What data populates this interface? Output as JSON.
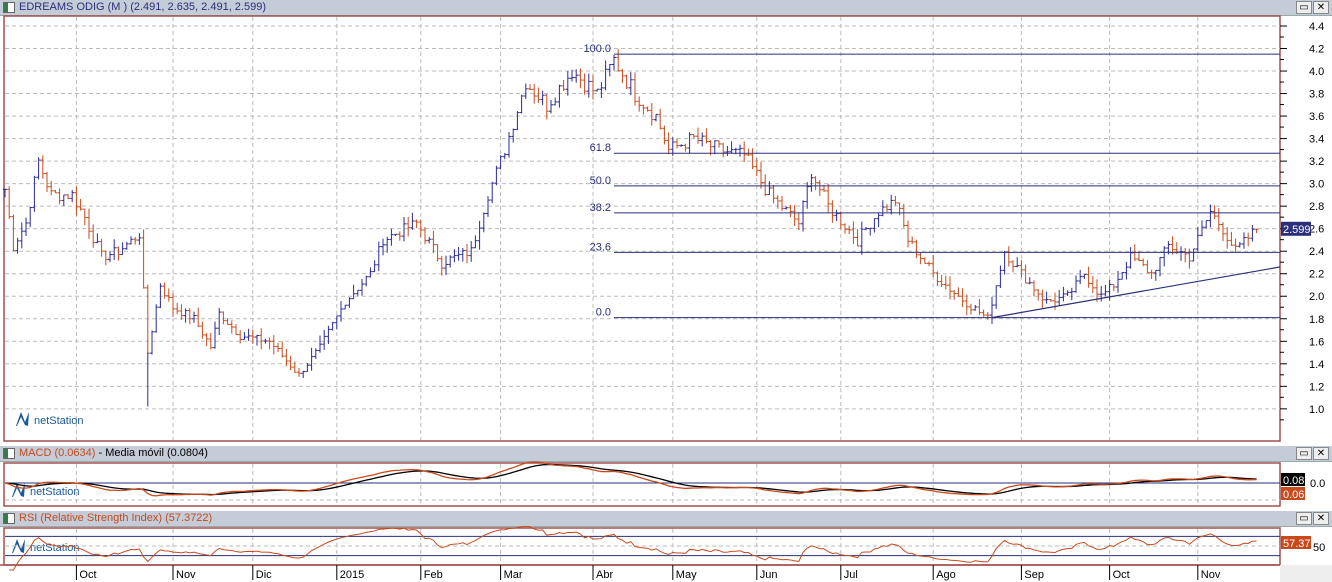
{
  "main_header": {
    "title": "EDREAMS ODIG (M ) (2.491, 2.635, 2.491, 2.599)",
    "last_price": "2.599"
  },
  "macd_header": {
    "macd": "MACD (0.0634)",
    "sep": " - ",
    "signal": "Media móvil (0.0804)",
    "value1": "0.08",
    "value2": "0.06",
    "zero_label": "0.0"
  },
  "rsi_header": {
    "title": "RSI (Relative Strength Index) (57.3722)",
    "value": "57.37",
    "mid_label": "50"
  },
  "watermark": "netStation",
  "buttons": {
    "maximize": "▭",
    "close": "✕"
  },
  "colors": {
    "up": "#2a2a9a",
    "down": "#c84a1c",
    "fib": "#2a2f7a",
    "frame": "#a05050",
    "macd": "#c84a1c",
    "signal": "#000000",
    "rsi": "#c84a1c"
  },
  "chart_data": {
    "type": "ohlc",
    "title": "EDREAMS ODIG (M )",
    "x_unit": "trading day index",
    "y_ticks": [
      "4.4",
      "4.2",
      "4.0",
      "3.8",
      "3.6",
      "3.4",
      "3.2",
      "3.0",
      "2.8",
      "2.6",
      "2.4",
      "2.2",
      "2.0",
      "1.8",
      "1.6",
      "1.4",
      "1.2",
      "1.0"
    ],
    "ylim": [
      0.85,
      4.55
    ],
    "x_ticks": [
      {
        "label": "Oct",
        "day": 17
      },
      {
        "label": "Nov",
        "day": 40
      },
      {
        "label": "Dic",
        "day": 59
      },
      {
        "label": "2015",
        "day": 79
      },
      {
        "label": "Feb",
        "day": 99
      },
      {
        "label": "Mar",
        "day": 118
      },
      {
        "label": "Abr",
        "day": 140
      },
      {
        "label": "May",
        "day": 159
      },
      {
        "label": "Jun",
        "day": 179
      },
      {
        "label": "Jul",
        "day": 199
      },
      {
        "label": "Ago",
        "day": 221
      },
      {
        "label": "Sep",
        "day": 242
      },
      {
        "label": "Oct",
        "day": 263
      },
      {
        "label": "Nov",
        "day": 284
      }
    ],
    "close_anchors": [
      [
        0,
        2.95
      ],
      [
        2,
        2.45
      ],
      [
        5,
        2.65
      ],
      [
        8,
        3.2
      ],
      [
        11,
        2.9
      ],
      [
        16,
        2.9
      ],
      [
        19,
        2.7
      ],
      [
        23,
        2.35
      ],
      [
        27,
        2.4
      ],
      [
        32,
        2.55
      ],
      [
        34,
        1.5
      ],
      [
        37,
        2.1
      ],
      [
        40,
        1.9
      ],
      [
        45,
        1.8
      ],
      [
        49,
        1.55
      ],
      [
        51,
        1.85
      ],
      [
        56,
        1.65
      ],
      [
        63,
        1.6
      ],
      [
        70,
        1.3
      ],
      [
        75,
        1.55
      ],
      [
        81,
        1.95
      ],
      [
        87,
        2.2
      ],
      [
        90,
        2.5
      ],
      [
        98,
        2.65
      ],
      [
        104,
        2.3
      ],
      [
        111,
        2.4
      ],
      [
        115,
        2.9
      ],
      [
        119,
        3.3
      ],
      [
        124,
        3.9
      ],
      [
        129,
        3.7
      ],
      [
        135,
        4.0
      ],
      [
        141,
        3.8
      ],
      [
        145,
        4.1
      ],
      [
        150,
        3.8
      ],
      [
        155,
        3.6
      ],
      [
        158,
        3.3
      ],
      [
        164,
        3.4
      ],
      [
        170,
        3.3
      ],
      [
        176,
        3.25
      ],
      [
        182,
        2.9
      ],
      [
        189,
        2.65
      ],
      [
        192,
        3.1
      ],
      [
        196,
        2.8
      ],
      [
        203,
        2.5
      ],
      [
        208,
        2.75
      ],
      [
        212,
        2.85
      ],
      [
        215,
        2.5
      ],
      [
        221,
        2.2
      ],
      [
        227,
        2.0
      ],
      [
        234,
        1.8
      ],
      [
        238,
        2.4
      ],
      [
        242,
        2.2
      ],
      [
        248,
        1.95
      ],
      [
        253,
        2.0
      ],
      [
        257,
        2.2
      ],
      [
        261,
        2.0
      ],
      [
        264,
        2.1
      ],
      [
        268,
        2.35
      ],
      [
        273,
        2.2
      ],
      [
        277,
        2.45
      ],
      [
        282,
        2.35
      ],
      [
        287,
        2.75
      ],
      [
        290,
        2.6
      ],
      [
        293,
        2.4
      ],
      [
        298,
        2.6
      ]
    ],
    "fibonacci": [
      {
        "label": "100.0",
        "value": 4.15
      },
      {
        "label": "61.8",
        "value": 3.27
      },
      {
        "label": "50.0",
        "value": 2.98
      },
      {
        "label": "38.2",
        "value": 2.74
      },
      {
        "label": "23.6",
        "value": 2.39
      },
      {
        "label": "0.0",
        "value": 1.81
      }
    ],
    "fib_start_day": 145,
    "trendline": [
      [
        235,
        1.81
      ],
      [
        303,
        2.26
      ]
    ],
    "macd_params": [
      12,
      26,
      9
    ],
    "rsi_period": 14,
    "rsi_levels": [
      30,
      50,
      70
    ]
  }
}
